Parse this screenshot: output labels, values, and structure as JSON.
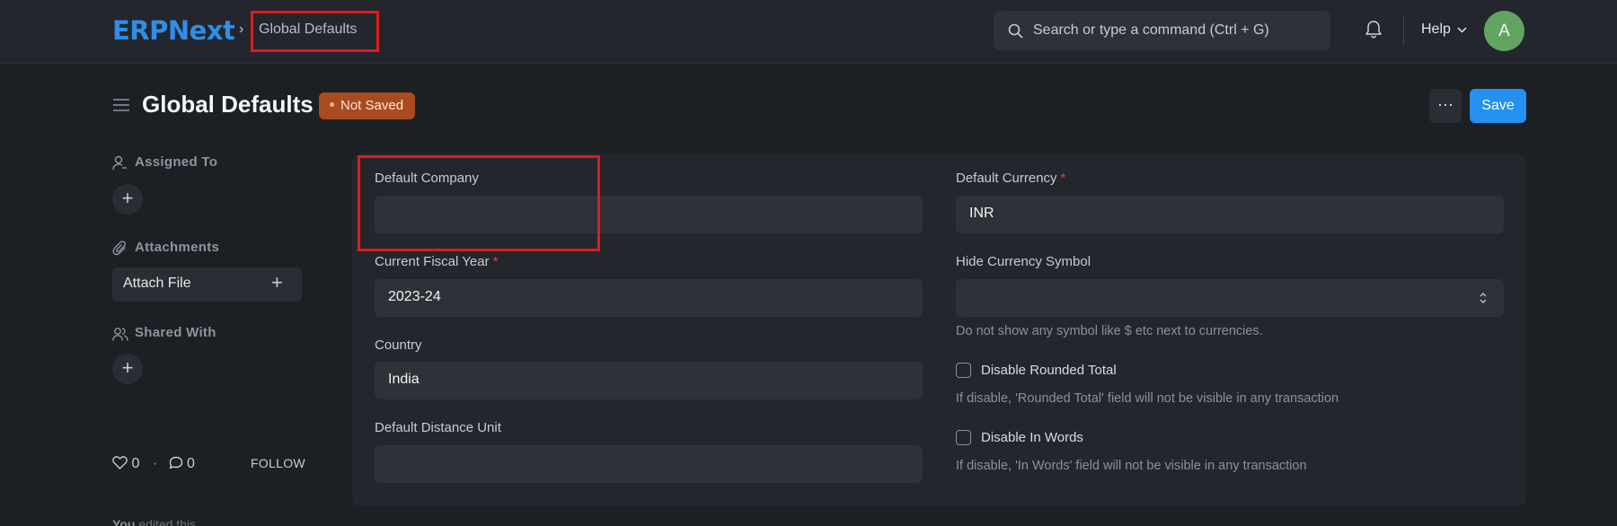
{
  "navbar": {
    "logo": "ERPNext",
    "breadcrumb_sep": "›",
    "breadcrumb": "Global Defaults",
    "search_placeholder": "Search or type a command (Ctrl + G)",
    "help_label": "Help",
    "avatar_initial": "A"
  },
  "page": {
    "title": "Global Defaults",
    "status_badge": "Not Saved",
    "more_label": "···",
    "save_label": "Save"
  },
  "sidebar": {
    "assigned_to": "Assigned To",
    "attachments": "Attachments",
    "attach_file": "Attach File",
    "shared_with": "Shared With",
    "add_symbol": "+",
    "likes_count": "0",
    "dot_sep": "·",
    "comments_count": "0",
    "follow": "FOLLOW",
    "edited_user": "You",
    "edited_text": "edited this"
  },
  "form": {
    "default_company": {
      "label": "Default Company",
      "value": ""
    },
    "current_fiscal_year": {
      "label": "Current Fiscal Year",
      "required": "*",
      "value": "2023-24"
    },
    "country": {
      "label": "Country",
      "value": "India"
    },
    "default_distance_unit": {
      "label": "Default Distance Unit",
      "value": ""
    },
    "default_currency": {
      "label": "Default Currency",
      "required": "*",
      "value": "INR"
    },
    "hide_currency_symbol": {
      "label": "Hide Currency Symbol",
      "value": "",
      "description": "Do not show any symbol like $ etc next to currencies."
    },
    "disable_rounded_total": {
      "label": "Disable Rounded Total",
      "checked": false,
      "description": "If disable, 'Rounded Total' field will not be visible in any transaction"
    },
    "disable_in_words": {
      "label": "Disable In Words",
      "checked": false,
      "description": "If disable, 'In Words' field will not be visible in any transaction"
    }
  },
  "colors": {
    "accent": "#2490ef",
    "badge": "#a94b1f",
    "highlight_box": "#e11b1b",
    "avatar": "#62a560"
  }
}
